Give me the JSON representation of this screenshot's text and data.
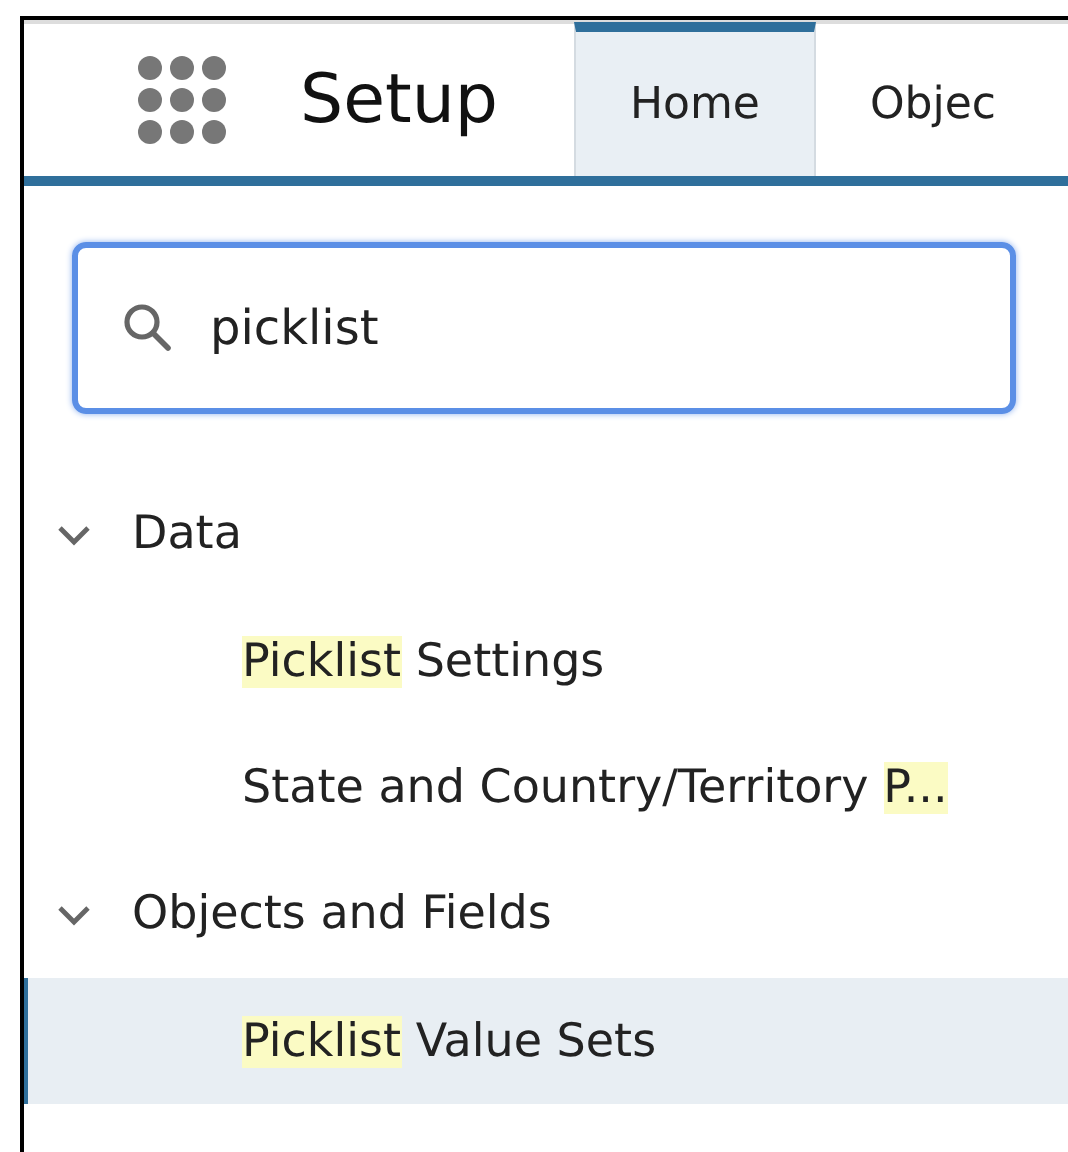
{
  "header": {
    "title": "Setup",
    "tabs": [
      {
        "label": "Home",
        "selected": true
      },
      {
        "label": "Objec",
        "selected": false
      }
    ]
  },
  "search": {
    "value": "picklist"
  },
  "tree": [
    {
      "label": "Data",
      "expanded": true,
      "children": [
        {
          "segments": [
            {
              "text": "Picklist",
              "highlight": true
            },
            {
              "text": " Settings",
              "highlight": false
            }
          ],
          "selected": false
        },
        {
          "segments": [
            {
              "text": "State and Country/Territory ",
              "highlight": false
            },
            {
              "text": "P...",
              "highlight": true
            }
          ],
          "selected": false
        }
      ]
    },
    {
      "label": "Objects and Fields",
      "expanded": true,
      "children": [
        {
          "segments": [
            {
              "text": "Picklist",
              "highlight": true
            },
            {
              "text": " Value Sets",
              "highlight": false
            }
          ],
          "selected": true
        }
      ]
    }
  ]
}
